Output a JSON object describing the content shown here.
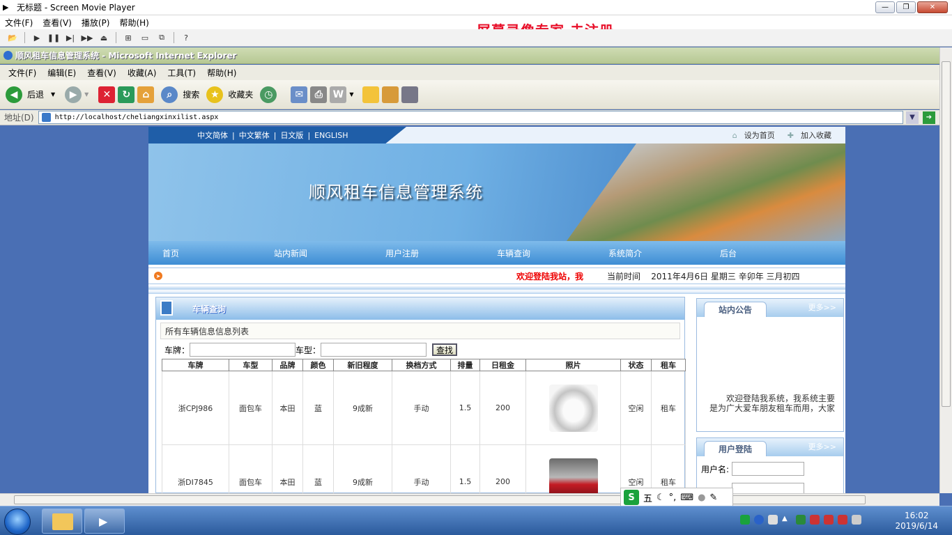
{
  "player": {
    "title": "无标题 - Screen Movie Player",
    "menu": [
      "文件(F)",
      "查看(V)",
      "播放(P)",
      "帮助(H)"
    ],
    "watermark": "屏幕录像专家  未注册"
  },
  "ie": {
    "title": "顺风租车信息管理系统 - Microsoft Internet Explorer",
    "menu": [
      "文件(F)",
      "编辑(E)",
      "查看(V)",
      "收藏(A)",
      "工具(T)",
      "帮助(H)"
    ],
    "back_label": "后退",
    "search_label": "搜索",
    "favorites_label": "收藏夹",
    "address_label": "地址(D)",
    "address_value": "http://localhost/cheliangxinxilist.aspx"
  },
  "site": {
    "languages": [
      "中文简体",
      "中文繁体",
      "日文版",
      "ENGLISH"
    ],
    "set_home": "设为首页",
    "add_fav": "加入收藏",
    "banner_title": "顺风租车信息管理系统",
    "nav": [
      "首页",
      "站内新闻",
      "用户注册",
      "车辆查询",
      "系统简介",
      "后台"
    ],
    "welcome": "欢迎登陆我站，我",
    "current_time_label": "当前时间",
    "current_time": "2011年4月6日 星期三 辛卯年 三月初四"
  },
  "main": {
    "header": "车辆查询",
    "list_caption": "所有车辆信息信息列表",
    "plate_label": "车牌：",
    "type_label": "车型：",
    "find_button": "查找",
    "columns": [
      "车牌",
      "车型",
      "品牌",
      "颜色",
      "新旧程度",
      "换档方式",
      "排量",
      "日租金",
      "照片",
      "状态",
      "租车"
    ],
    "rows": [
      {
        "plate": "浙CPJ986",
        "type": "面包车",
        "brand": "本田",
        "color": "蓝",
        "condition": "9成新",
        "gear": "手动",
        "displacement": "1.5",
        "rent": "200",
        "status": "空闲",
        "action": "租车"
      },
      {
        "plate": "浙DI7845",
        "type": "面包车",
        "brand": "本田",
        "color": "蓝",
        "condition": "9成新",
        "gear": "手动",
        "displacement": "1.5",
        "rent": "200",
        "status": "空闲",
        "action": "租车"
      }
    ]
  },
  "sidebar": {
    "notice_title": "站内公告",
    "notice_more": "更多>>",
    "notice_text": "欢迎登陆我系统，我系统主要是为广大爱车朋友租车而用，大家",
    "login_title": "用户登陆",
    "login_more": "更多>>",
    "username_label": "用户名:"
  },
  "ime": {
    "label": "五"
  },
  "taskbar": {
    "time": "16:02",
    "date": "2019/6/14"
  }
}
